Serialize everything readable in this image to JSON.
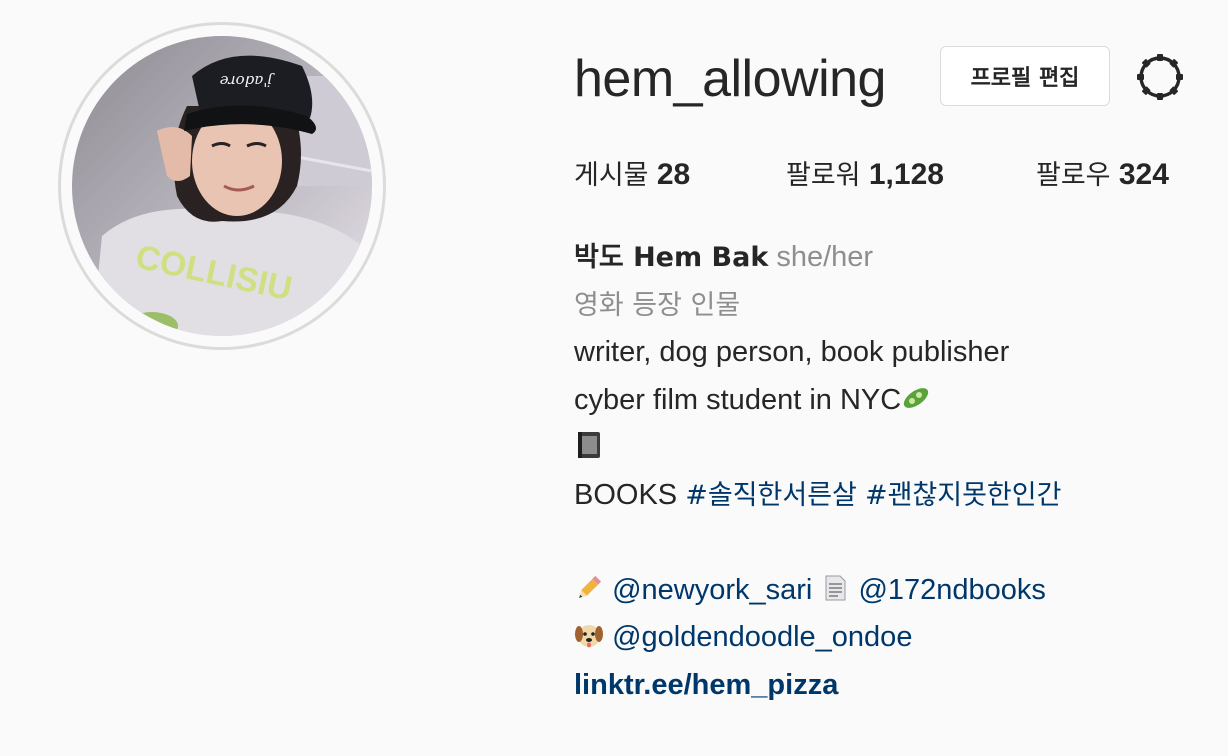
{
  "profile": {
    "username": "hem_allowing",
    "edit_button": "프로필 편집",
    "settings_icon": "gear-icon"
  },
  "stats": {
    "posts_label": "게시물",
    "posts_count": "28",
    "followers_label": "팔로워",
    "followers_count": "1,128",
    "following_label": "팔로우",
    "following_count": "324"
  },
  "bio": {
    "name": "박도 Hem Bak",
    "pronouns": "she/her",
    "category": "영화 등장 인물",
    "line1": "writer, dog person, book publisher",
    "line2": "cyber film student in NYC",
    "line2_emoji": "cucumber-emoji",
    "line3_emoji": "notebook-emoji",
    "books_prefix": "BOOKS",
    "hashtag1": "#솔직한서른살",
    "hashtag2": "#괜찮지못한인간",
    "pencil_emoji": "pencil-emoji",
    "mention1": "@newyork_sari",
    "page_emoji": "page-emoji",
    "mention2": "@172ndbooks",
    "dog_emoji": "dog-face-emoji",
    "mention3": "@goldendoodle_ondoe",
    "link": "linktr.ee/hem_pizza"
  },
  "colors": {
    "background": "#fafafa",
    "text": "#262626",
    "secondary": "#8e8e8e",
    "link": "#00376b",
    "border": "#dbdbdb"
  }
}
